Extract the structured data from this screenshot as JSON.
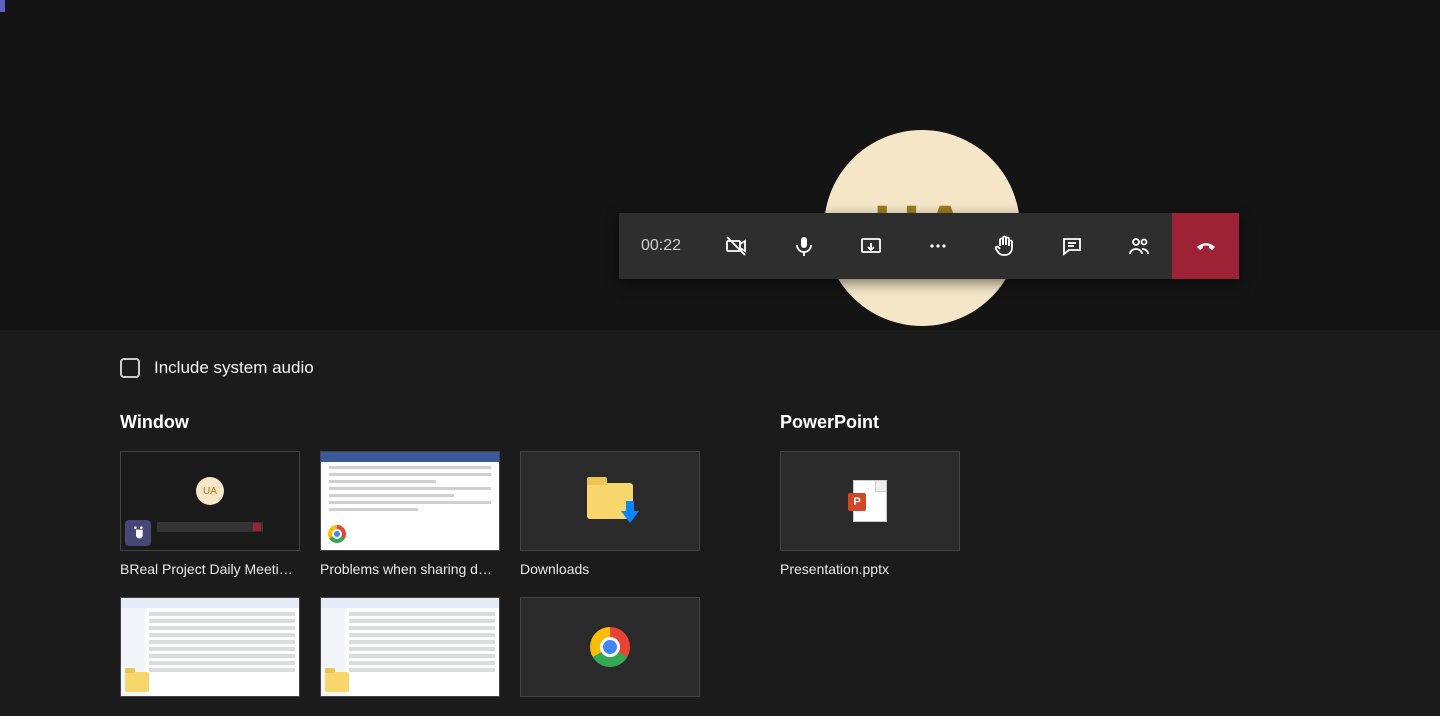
{
  "call": {
    "timer": "00:22",
    "avatar_initials": "UA"
  },
  "share": {
    "include_audio_label": "Include system audio",
    "include_audio_checked": false,
    "sections": {
      "window": {
        "title": "Window"
      },
      "powerpoint": {
        "title": "PowerPoint"
      }
    },
    "windows": [
      {
        "label": "BReal Project Daily Meeti…",
        "kind": "teams"
      },
      {
        "label": "Problems when sharing d…",
        "kind": "chrome-page"
      },
      {
        "label": "Downloads",
        "kind": "folder"
      },
      {
        "label": "",
        "kind": "explorer"
      },
      {
        "label": "",
        "kind": "explorer"
      },
      {
        "label": "",
        "kind": "chrome-blank"
      }
    ],
    "powerpoint_files": [
      {
        "label": "Presentation.pptx"
      }
    ]
  }
}
